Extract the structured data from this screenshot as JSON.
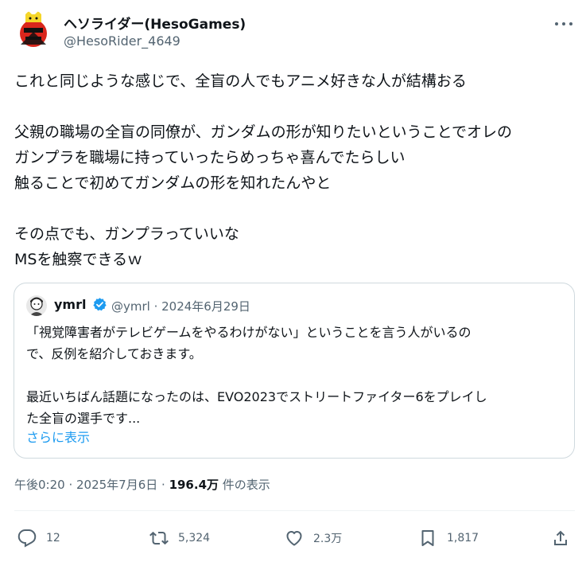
{
  "author": {
    "display_name": "ヘソライダー(HesoGames)",
    "handle": "@HesoRider_4649",
    "avatar_icon": "heso-rider-avatar-icon"
  },
  "tweet": {
    "lines": [
      "これと同じような感じで、全盲の人でもアニメ好きな人が結構おる",
      "",
      "父親の職場の全盲の同僚が、ガンダムの形が知りたいということでオレの",
      "ガンプラを職場に持っていったらめっちゃ喜んでたらしい",
      "触ることで初めてガンダムの形を知れたんやと",
      "",
      "その点でも、ガンプラっていいな",
      "MSを触察できるｗ"
    ]
  },
  "quote": {
    "name": "ymrl",
    "verified": true,
    "meta": "@ymrl · 2024年6月29日",
    "lines": [
      "「視覚障害者がテレビゲームをやるわけがない」ということを言う人がいるの",
      "で、反例を紹介しておきます。",
      "",
      "最近いちばん話題になったのは、EVO2023でストリートファイター6をプレイし",
      "た全盲の選手です..."
    ],
    "show_more": "さらに表示"
  },
  "timestamp": {
    "time": "午後0:20 · 2025年7月6日 · ",
    "views_count": "196.4万",
    "views_label": " 件の表示"
  },
  "actions": {
    "reply": "12",
    "retweet": "5,324",
    "like": "2.3万",
    "bookmark": "1,817"
  },
  "colors": {
    "text": "#0f1419",
    "secondary": "#536471",
    "link": "#1d9bf0",
    "border": "#cfd9de"
  }
}
